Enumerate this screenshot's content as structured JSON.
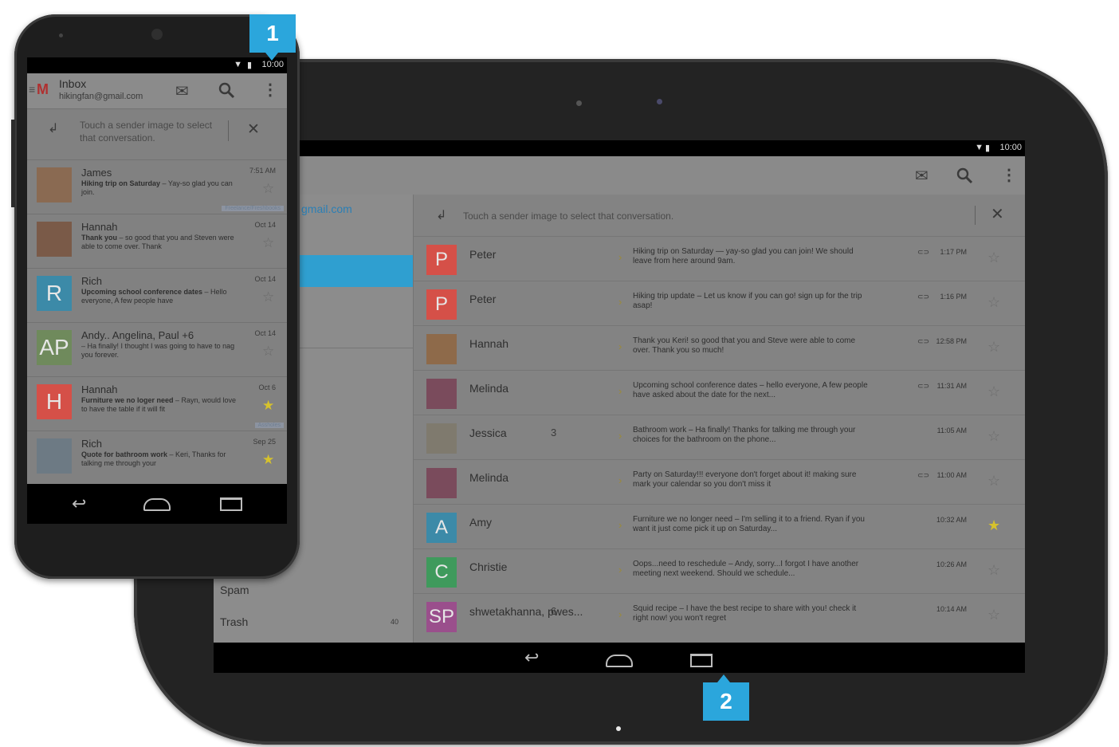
{
  "colors": {
    "badge": "#2ba6dc",
    "star_on": "#d6c22c",
    "selected_drawer": "#2f9fd0"
  },
  "badges": {
    "phone": "1",
    "tablet": "2"
  },
  "tablet": {
    "status_time": "10:00",
    "drawer": {
      "account_fragment": "gmail.com",
      "spam_label": "Spam",
      "trash_label": "Trash",
      "trash_count": "40"
    },
    "tip": {
      "text": "Touch a sender image to select that conversation."
    },
    "rows": [
      {
        "avatar_letter": "P",
        "avatar_color": "#d55048",
        "sender": "Peter",
        "count": "",
        "snippet": "Hiking trip on Saturday — yay-so glad you can join! We should leave from here around 9am.",
        "attach": "⊂⊃",
        "time": "1:17 PM",
        "starred": false
      },
      {
        "avatar_letter": "P",
        "avatar_color": "#d55048",
        "sender": "Peter",
        "count": "",
        "snippet": "Hiking trip update – Let us know if you can go! sign up for the trip asap!",
        "attach": "⊂⊃",
        "time": "1:16 PM",
        "starred": false
      },
      {
        "avatar_letter": "",
        "avatar_color": "#8e6a4a",
        "sender": "Hannah",
        "count": "",
        "snippet": "Thank you Keri! so good that you and Steve were able to come over. Thank you so much!",
        "attach": "⊂⊃",
        "time": "12:58 PM",
        "starred": false
      },
      {
        "avatar_letter": "",
        "avatar_color": "#7a4b5c",
        "sender": "Melinda",
        "count": "",
        "snippet": "Upcoming school conference dates – hello everyone, A few people have asked about the date for the next...",
        "attach": "⊂⊃",
        "time": "11:31 AM",
        "starred": false
      },
      {
        "avatar_letter": "",
        "avatar_color": "#7f7a6e",
        "sender": "Jessica",
        "count": "3",
        "snippet": "Bathroom work – Ha finally! Thanks for talking me through your choices for the bathroom on the phone...",
        "attach": "",
        "time": "11:05 AM",
        "starred": false
      },
      {
        "avatar_letter": "",
        "avatar_color": "#7a4b5c",
        "sender": "Melinda",
        "count": "",
        "snippet": "Party on Saturday!!! everyone don't forget about it! making sure mark your calendar so you don't miss it",
        "attach": "⊂⊃",
        "time": "11:00 AM",
        "starred": false
      },
      {
        "avatar_letter": "A",
        "avatar_color": "#3c8aa8",
        "sender": "Amy",
        "count": "",
        "snippet": "Furniture we no longer need – I'm selling it to a friend. Ryan if you want it just come pick it up on Saturday...",
        "attach": "",
        "time": "10:32 AM",
        "starred": true
      },
      {
        "avatar_letter": "C",
        "avatar_color": "#3f9a5c",
        "sender": "Christie",
        "count": "",
        "snippet": "Oops...need to reschedule – Andy, sorry...I forgot I have another meeting next weekend. Should we schedule...",
        "attach": "",
        "time": "10:26 AM",
        "starred": false
      },
      {
        "avatar_letter": "SP",
        "avatar_color": "#9a4f8c",
        "sender": "shwetakhanna, pwes...",
        "count": "6",
        "snippet": "Squid recipe – I have the best recipe to share with you! check it right now! you won't regret",
        "attach": "",
        "time": "10:14 AM",
        "starred": false
      }
    ]
  },
  "phone": {
    "status_time": "10:00",
    "title": "Inbox",
    "account": "hikingfan@gmail.com",
    "tip": "Touch a sender image to select that conversation.",
    "rows": [
      {
        "avatar_letter": "",
        "avatar_color": "#8a6a52",
        "sender": "James",
        "time": "7:51 AM",
        "subject": "Hiking trip on Saturday",
        "snippet": " – Yay-so glad you can join.",
        "label": "Freelance/Freshbooks",
        "starred": false
      },
      {
        "avatar_letter": "",
        "avatar_color": "#7a5a48",
        "sender": "Hannah",
        "time": "Oct 14",
        "subject": "Thank you",
        "snippet": " – so good that you and Steven were able to come over. Thank",
        "label": "",
        "starred": false
      },
      {
        "avatar_letter": "R",
        "avatar_color": "#3c8aa8",
        "sender": "Rich",
        "time": "Oct 14",
        "subject": "Upcoming school conference dates",
        "snippet": " – Hello everyone, A few people have",
        "label": "",
        "starred": false
      },
      {
        "avatar_letter": "AP",
        "avatar_color": "#6f8a5c",
        "sender": "Andy.. Angelina, Paul +6",
        "time": "Oct 14",
        "subject": "",
        "snippet": "– Ha finally! I thought I was going to have to nag you forever.",
        "label": "",
        "starred": false
      },
      {
        "avatar_letter": "H",
        "avatar_color": "#d55048",
        "sender": "Hannah",
        "time": "Oct 6",
        "subject": "Furniture we no loger need",
        "snippet": " – Rayn, would love to have the table if it will fit",
        "label": "Assholes",
        "starred": true
      },
      {
        "avatar_letter": "",
        "avatar_color": "#6d7a84",
        "sender": "Rich",
        "time": "Sep 25",
        "subject": "Quote for bathroom work",
        "snippet": " – Keri, Thanks for talking me through your",
        "label": "",
        "starred": true
      }
    ]
  }
}
